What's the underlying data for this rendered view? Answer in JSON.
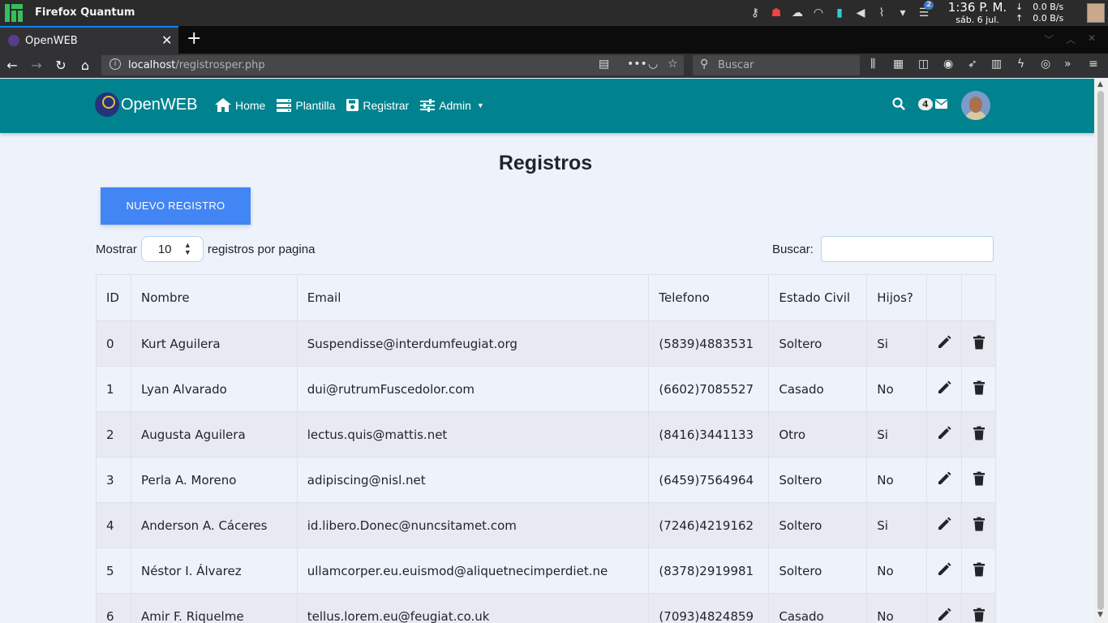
{
  "system": {
    "app_title": "Firefox Quantum",
    "clock_time": "1:36 P. M.",
    "clock_date": "sáb. 6 jul.",
    "net_down": "0.0 B/s",
    "net_up": "0.0 B/s",
    "notif_count": "2",
    "down_arrow": "↓",
    "up_arrow": "↑"
  },
  "browser": {
    "tab_title": "OpenWEB",
    "url_host": "localhost",
    "url_path": "/registrosper.php",
    "search_placeholder": "Buscar"
  },
  "site": {
    "brand": "OpenWEB",
    "nav": [
      {
        "label": "Home",
        "icon": "home-icon"
      },
      {
        "label": "Plantilla",
        "icon": "server-icon"
      },
      {
        "label": "Registrar",
        "icon": "save-icon"
      },
      {
        "label": "Admin",
        "icon": "sliders-icon"
      }
    ],
    "mail_badge": "4"
  },
  "page": {
    "title": "Registros",
    "new_button": "NUEVO REGISTRO",
    "show_label": "Mostrar",
    "page_size": "10",
    "page_size_suffix": "registros por pagina",
    "search_label": "Buscar:"
  },
  "table": {
    "headers": [
      "ID",
      "Nombre",
      "Email",
      "Telefono",
      "Estado Civil",
      "Hijos?",
      "",
      ""
    ],
    "rows": [
      {
        "id": "0",
        "nombre": "Kurt Aguilera",
        "email": "Suspendisse@interdumfeugiat.org",
        "telefono": "(5839)4883531",
        "estado": "Soltero",
        "hijos": "Si"
      },
      {
        "id": "1",
        "nombre": "Lyan Alvarado",
        "email": "dui@rutrumFuscedolor.com",
        "telefono": "(6602)7085527",
        "estado": "Casado",
        "hijos": "No"
      },
      {
        "id": "2",
        "nombre": "Augusta Aguilera",
        "email": "lectus.quis@mattis.net",
        "telefono": "(8416)3441133",
        "estado": "Otro",
        "hijos": "Si"
      },
      {
        "id": "3",
        "nombre": "Perla A. Moreno",
        "email": "adipiscing@nisl.net",
        "telefono": "(6459)7564964",
        "estado": "Soltero",
        "hijos": "No"
      },
      {
        "id": "4",
        "nombre": "Anderson A. Cáceres",
        "email": "id.libero.Donec@nuncsitamet.com",
        "telefono": "(7246)4219162",
        "estado": "Soltero",
        "hijos": "Si"
      },
      {
        "id": "5",
        "nombre": "Néstor I. Álvarez",
        "email": "ullamcorper.eu.euismod@aliquetnecimperdiet.ne",
        "telefono": "(8378)2919981",
        "estado": "Soltero",
        "hijos": "No"
      },
      {
        "id": "6",
        "nombre": "Amir F. Riquelme",
        "email": "tellus.lorem.eu@feugiat.co.uk",
        "telefono": "(7093)4824859",
        "estado": "Casado",
        "hijos": "No"
      }
    ]
  },
  "colors": {
    "navbar": "#00838f",
    "primary_button": "#4285f4",
    "page_bg": "#eef2fb"
  }
}
